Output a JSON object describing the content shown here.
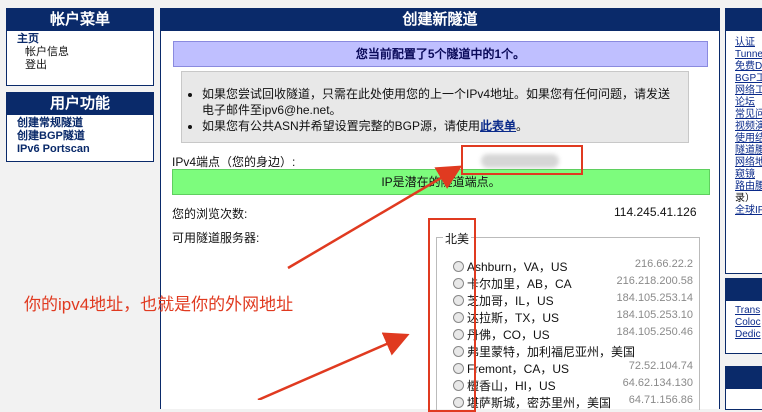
{
  "account_menu": {
    "title": "帐户菜单",
    "items": [
      {
        "label": "主页",
        "level": "top"
      },
      {
        "label": "帐户信息",
        "level": "sub"
      },
      {
        "label": "登出",
        "level": "sub"
      }
    ]
  },
  "user_functions": {
    "title": "用户功能",
    "items": [
      "创建常规隧道",
      "创建BGP隧道",
      "IPv6 Portscan"
    ]
  },
  "main": {
    "title": "创建新隧道",
    "notice": "您当前配置了5个隧道中的1个。",
    "info_item_1": "如果您尝试回收隧道，只需在此处使用您的上一个IPv4地址。如果您有任何问题，请发送电子邮件至ipv6@he.net。",
    "info_item_2_prefix": "如果您有公共ASN并希望设置完整的BGP源，请使用",
    "info_item_2_link": "此表单",
    "info_item_2_suffix": "。",
    "ipv4_label": "IPv4端点（您的身边）:",
    "green_status": "IP是潜在的隧道端点。",
    "browse_label": "您的浏览次数:",
    "browse_value": "114.245.41.126",
    "servers_label": "可用隧道服务器:",
    "region": "北美",
    "servers": [
      {
        "name": "Ashburn，VA，US",
        "ip": "216.66.22.2"
      },
      {
        "name": "卡尔加里，AB，CA",
        "ip": "216.218.200.58"
      },
      {
        "name": "芝加哥，IL，US",
        "ip": "184.105.253.14"
      },
      {
        "name": "达拉斯，TX，US",
        "ip": "184.105.253.10"
      },
      {
        "name": "丹佛，CO，US",
        "ip": "184.105.250.46"
      },
      {
        "name": "弗里蒙特，加利福尼亚州，美国",
        "ip": ""
      },
      {
        "name": "Fremont，CA，US",
        "ip": "72.52.104.74"
      },
      {
        "name": "檀香山，HI，US",
        "ip": "64.62.134.130"
      },
      {
        "name": "堪萨斯城，密苏里州，美国",
        "ip": "64.71.156.86"
      }
    ]
  },
  "right_sidebar": {
    "links_1": [
      "认证",
      "Tunne",
      "免费D",
      "BGP工",
      "网络工",
      "论坛",
      "常见问",
      "视频演",
      "使用结",
      "隧道腰",
      "网络地",
      "窥镜",
      "路由腰",
      "录）",
      "全球IP"
    ],
    "links_2": [
      "Trans",
      "Coloc",
      "Dedic"
    ]
  },
  "annotation": {
    "text": "你的ipv4地址，也就是你的外网地址",
    "color": "#e03a20"
  }
}
